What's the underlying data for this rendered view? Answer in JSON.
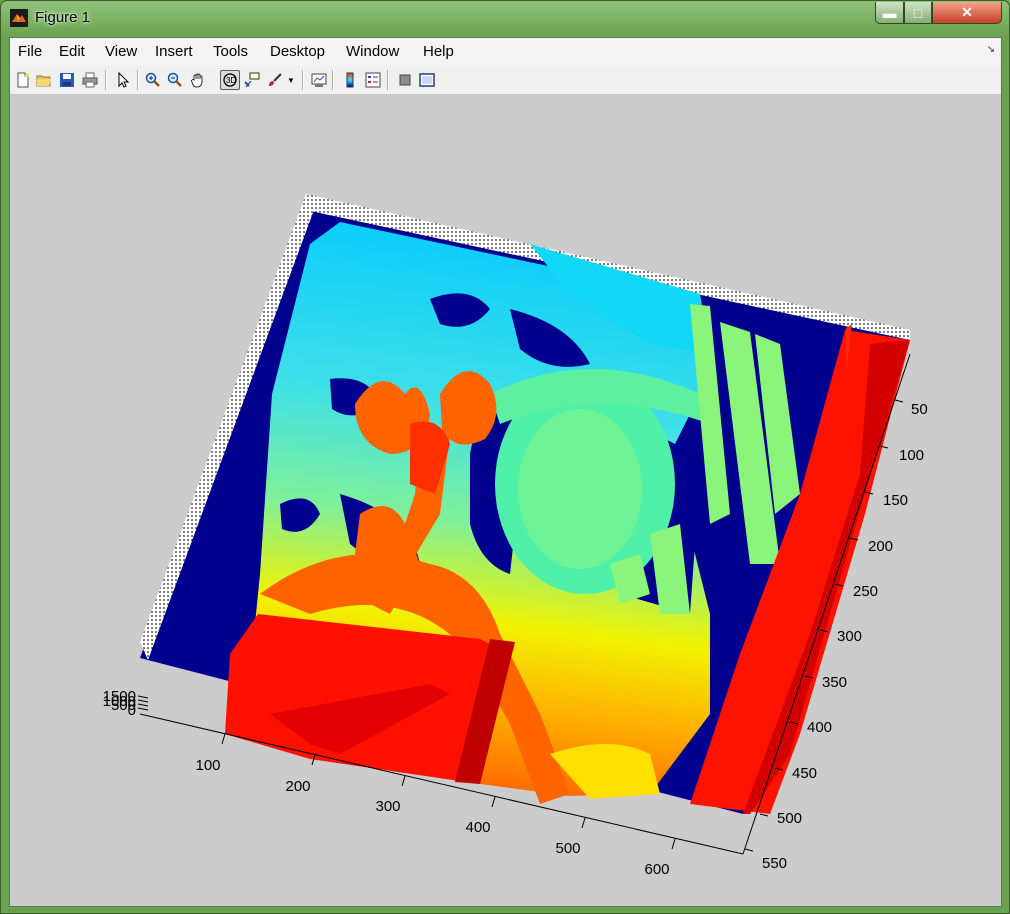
{
  "window": {
    "title": "Figure 1"
  },
  "menu": [
    "File",
    "Edit",
    "View",
    "Insert",
    "Tools",
    "Desktop",
    "Window",
    "Help"
  ],
  "toolbar": [
    "new-figure",
    "open-file",
    "save-figure",
    "print-figure",
    "edit-plot",
    "zoom-in",
    "zoom-out",
    "pan",
    "rotate-3d",
    "data-cursor",
    "brush",
    "link-plot",
    "insert-colorbar",
    "insert-legend",
    "hide-plot-tools",
    "show-plot-tools"
  ],
  "chart_data": {
    "type": "surface",
    "colormap": "jet",
    "x_ticks": [
      "100",
      "200",
      "300",
      "400",
      "500",
      "600"
    ],
    "y_ticks": [
      "50",
      "100",
      "150",
      "200",
      "250",
      "300",
      "350",
      "400",
      "450",
      "500",
      "550"
    ],
    "z_ticks": [
      "1500",
      "1000",
      "500",
      "0"
    ]
  },
  "colors": {
    "background": "#cccccc",
    "low": "#00008f",
    "high": "#ff1200"
  }
}
